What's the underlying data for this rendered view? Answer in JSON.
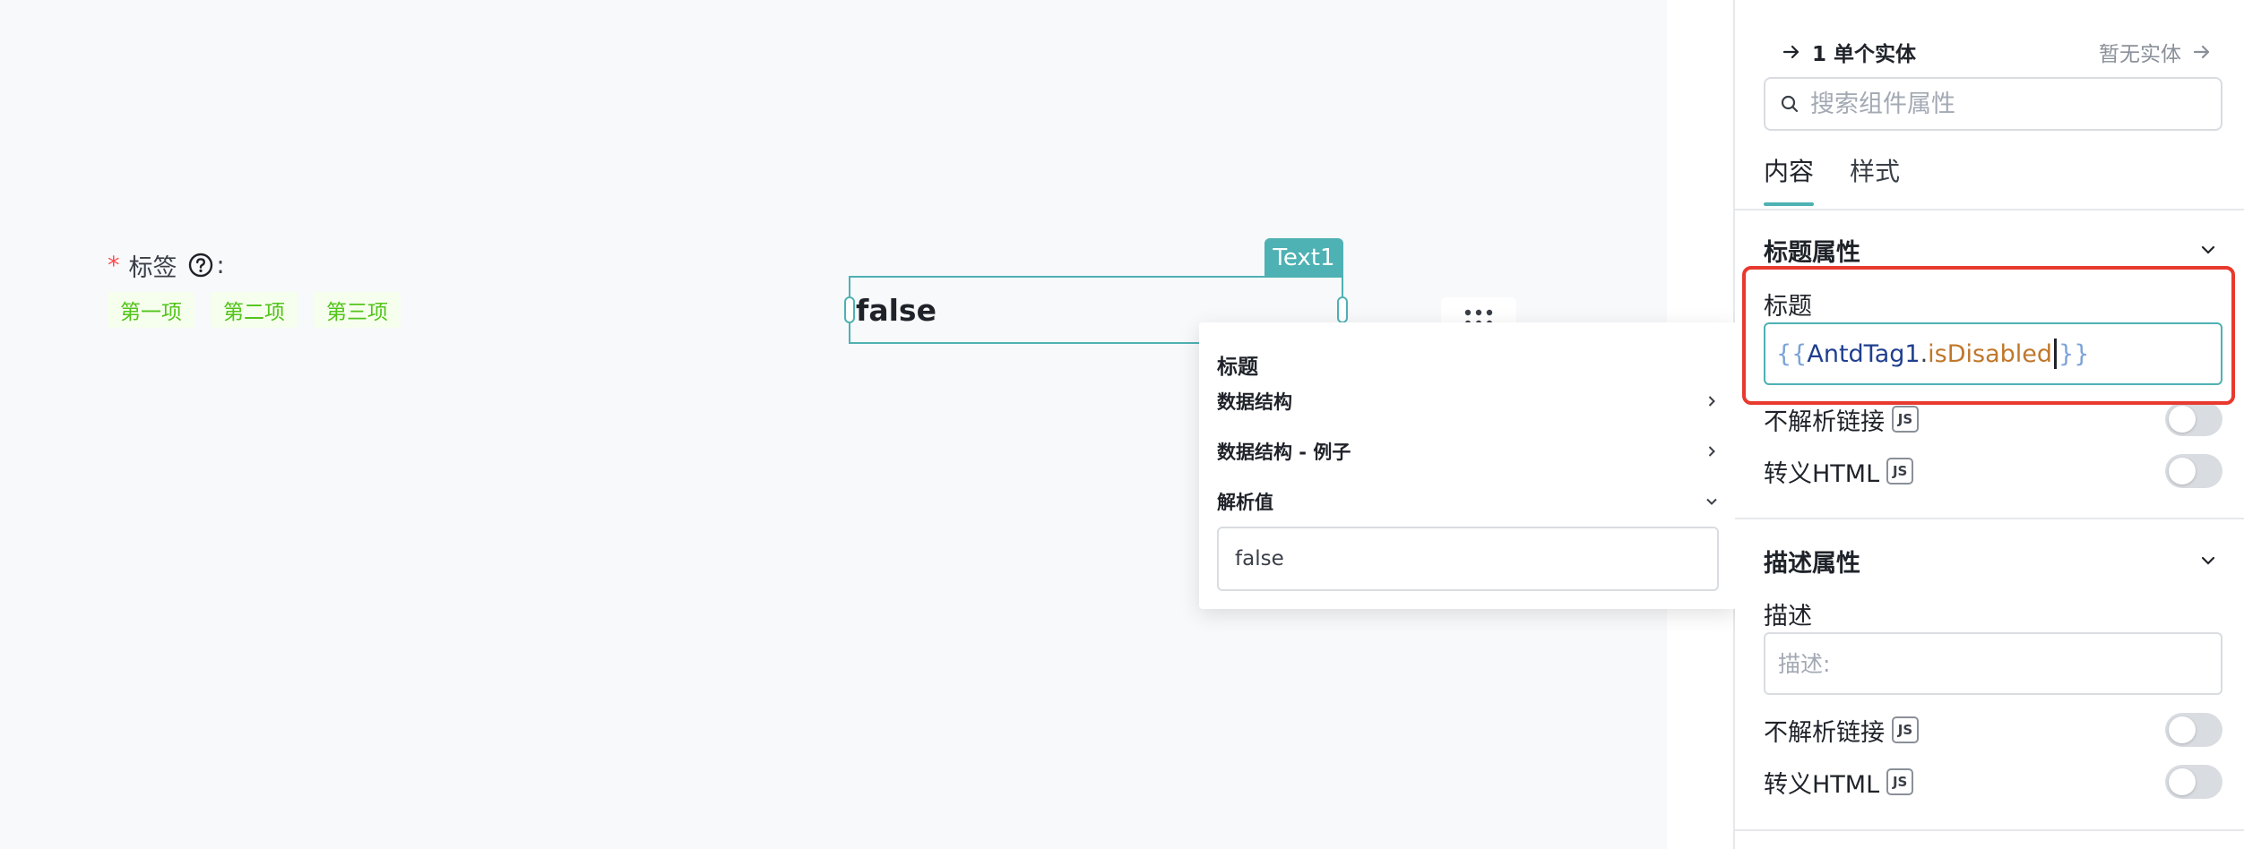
{
  "canvas": {
    "tag_field": {
      "required_mark": "*",
      "label": "标签",
      "colon": ":",
      "tags": [
        "第一项",
        "第二项",
        "第三项"
      ]
    },
    "text_component": {
      "name": "Text1",
      "value": "false"
    },
    "evaluation_popover": {
      "title": "标题",
      "rows": [
        "数据结构",
        "数据结构 - 例子",
        "解析值"
      ],
      "evaluated_value": "false"
    }
  },
  "panel": {
    "entity_nav": {
      "left_label": "1 单个实体",
      "right_label": "暂无实体"
    },
    "search": {
      "placeholder": "搜索组件属性"
    },
    "tabs": [
      "内容",
      "样式"
    ],
    "title_section": {
      "header": "标题属性",
      "field_label": "标题",
      "code": {
        "open": "{{",
        "object": "AntdTag1",
        "dot": ".",
        "property": "isDisabled",
        "close": "}}"
      },
      "toggles": [
        {
          "label": "不解析链接",
          "badge": "JS",
          "on": false
        },
        {
          "label": "转义HTML",
          "badge": "JS",
          "on": false
        }
      ]
    },
    "description_section": {
      "header": "描述属性",
      "field_label": "描述",
      "placeholder": "描述:",
      "toggles": [
        {
          "label": "不解析链接",
          "badge": "JS",
          "on": false
        },
        {
          "label": "转义HTML",
          "badge": "JS",
          "on": false
        }
      ]
    }
  },
  "colors": {
    "accent": "#4eb1b3",
    "highlight": "#e8392f",
    "tag_text": "#52c41a",
    "tag_bg": "#f6ffed",
    "required": "#ff4d4f"
  }
}
